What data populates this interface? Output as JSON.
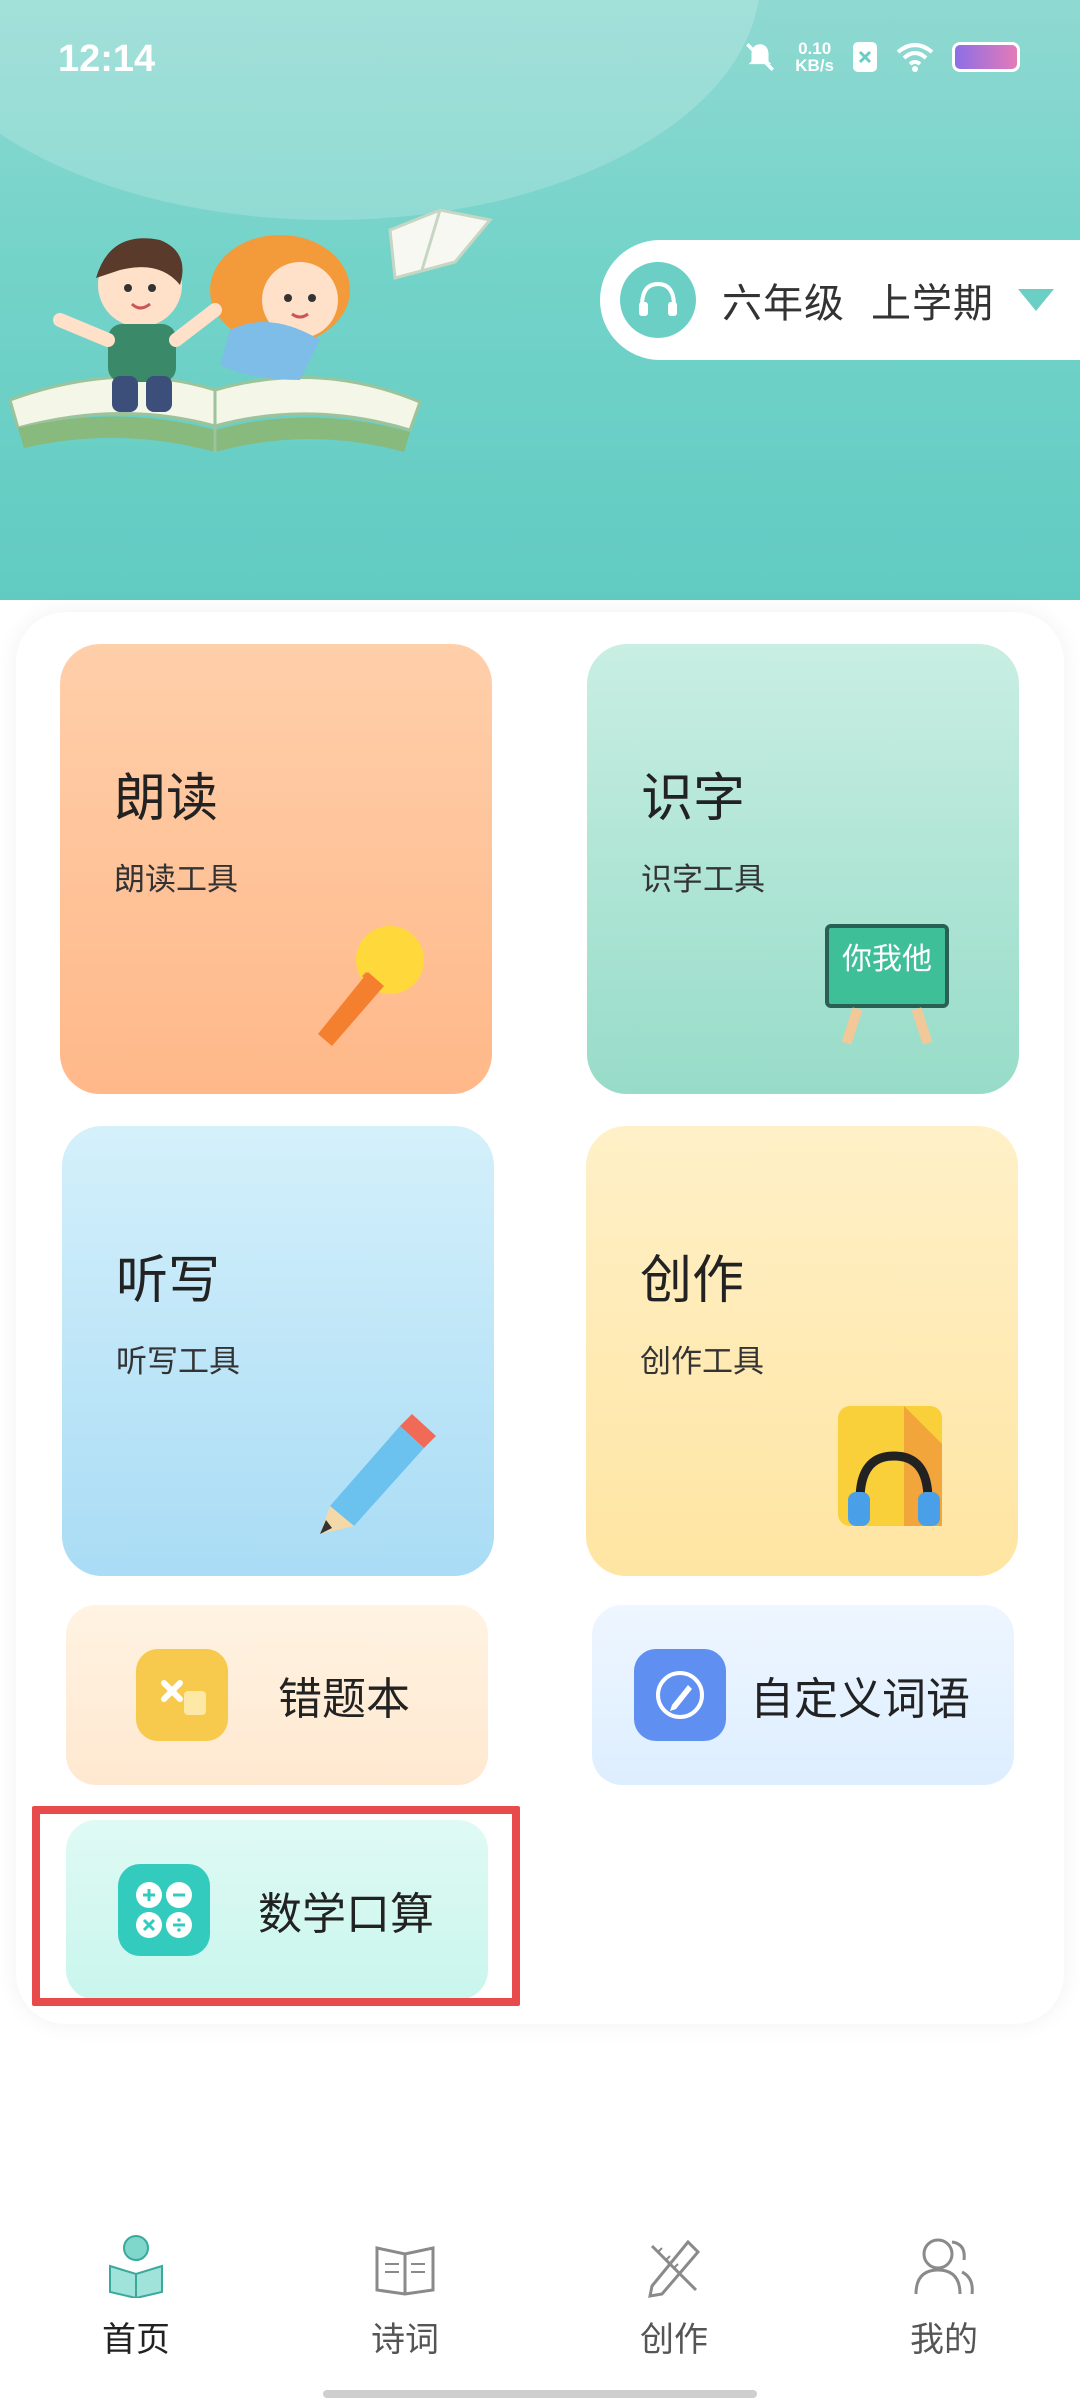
{
  "status_bar": {
    "time": "12:14",
    "net_speed_value": "0.10",
    "net_speed_unit": "KB/s"
  },
  "header": {
    "grade": "六年级",
    "term": "上学期",
    "accent_color": "#6ccfc6"
  },
  "cards": [
    {
      "title": "朗读",
      "subtitle": "朗读工具",
      "icon": "microphone-icon"
    },
    {
      "title": "识字",
      "subtitle": "识字工具",
      "icon": "blackboard-icon",
      "board_text": "你我他"
    },
    {
      "title": "听写",
      "subtitle": "听写工具",
      "icon": "pencil-icon"
    },
    {
      "title": "创作",
      "subtitle": "创作工具",
      "icon": "headphone-notebook-icon"
    }
  ],
  "shortcuts": [
    {
      "label": "错题本",
      "icon": "wrong-notebook-icon"
    },
    {
      "label": "自定义词语",
      "icon": "custom-pen-icon"
    },
    {
      "label": "数学口算",
      "icon": "calculator-icon"
    }
  ],
  "bottom_nav": [
    {
      "label": "首页",
      "icon": "home-reading-icon",
      "active": true
    },
    {
      "label": "诗词",
      "icon": "book-icon",
      "active": false
    },
    {
      "label": "创作",
      "icon": "pencil-ruler-icon",
      "active": false
    },
    {
      "label": "我的",
      "icon": "profile-icon",
      "active": false
    }
  ]
}
